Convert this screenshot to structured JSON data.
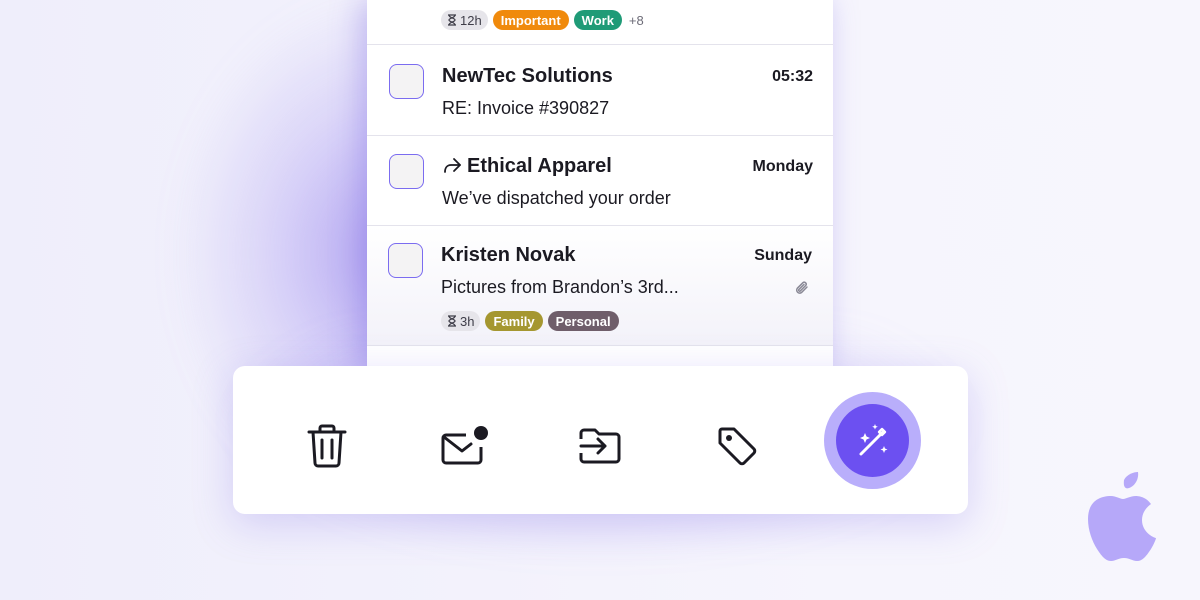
{
  "emails": {
    "top": {
      "snooze": "12h",
      "tags": [
        {
          "label": "Important",
          "color": "#f08a0c"
        },
        {
          "label": "Work",
          "color": "#1f9b77"
        }
      ],
      "more": "+8"
    },
    "items": [
      {
        "sender": "NewTec Solutions",
        "subject": "RE: Invoice #390827",
        "time": "05:32",
        "forwarded": false
      },
      {
        "sender": "Ethical Apparel",
        "subject": "We’ve dispatched your order",
        "time": "Monday",
        "forwarded": true
      },
      {
        "sender": "Kristen Novak",
        "subject": "Pictures from Brandon’s 3rd...",
        "time": "Sunday",
        "attachment": true,
        "snooze": "3h",
        "tags": [
          {
            "label": "Family",
            "color": "#a59730"
          },
          {
            "label": "Personal",
            "color": "#6f5e6a"
          }
        ]
      }
    ]
  },
  "toolbar": {
    "actions": [
      {
        "icon": "trash-icon"
      },
      {
        "icon": "mark-unread-icon"
      },
      {
        "icon": "move-to-folder-icon"
      },
      {
        "icon": "tag-icon"
      },
      {
        "icon": "magic-wand-icon",
        "accent": "#6c50f1"
      }
    ]
  },
  "brand": {
    "logo": "apple-logo",
    "color": "#b6a8f9"
  }
}
